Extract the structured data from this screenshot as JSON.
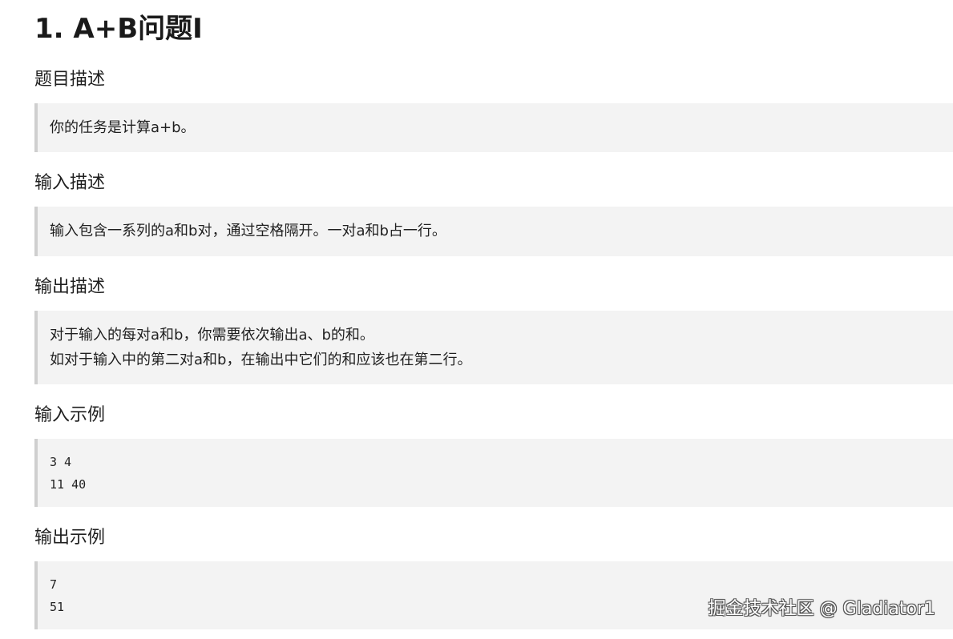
{
  "title": "1. A+B问题I",
  "sections": [
    {
      "heading": "题目描述",
      "lines": [
        "你的任务是计算a+b。"
      ]
    },
    {
      "heading": "输入描述",
      "lines": [
        "输入包含一系列的a和b对，通过空格隔开。一对a和b占一行。"
      ]
    },
    {
      "heading": "输出描述",
      "lines": [
        "对于输入的每对a和b，你需要依次输出a、b的和。",
        "如对于输入中的第二对a和b，在输出中它们的和应该也在第二行。"
      ]
    },
    {
      "heading": "输入示例",
      "code": [
        "3 4",
        "11 40"
      ]
    },
    {
      "heading": "输出示例",
      "code": [
        "7",
        "51"
      ]
    }
  ],
  "watermark": "掘金技术社区 @ Gladiator1"
}
